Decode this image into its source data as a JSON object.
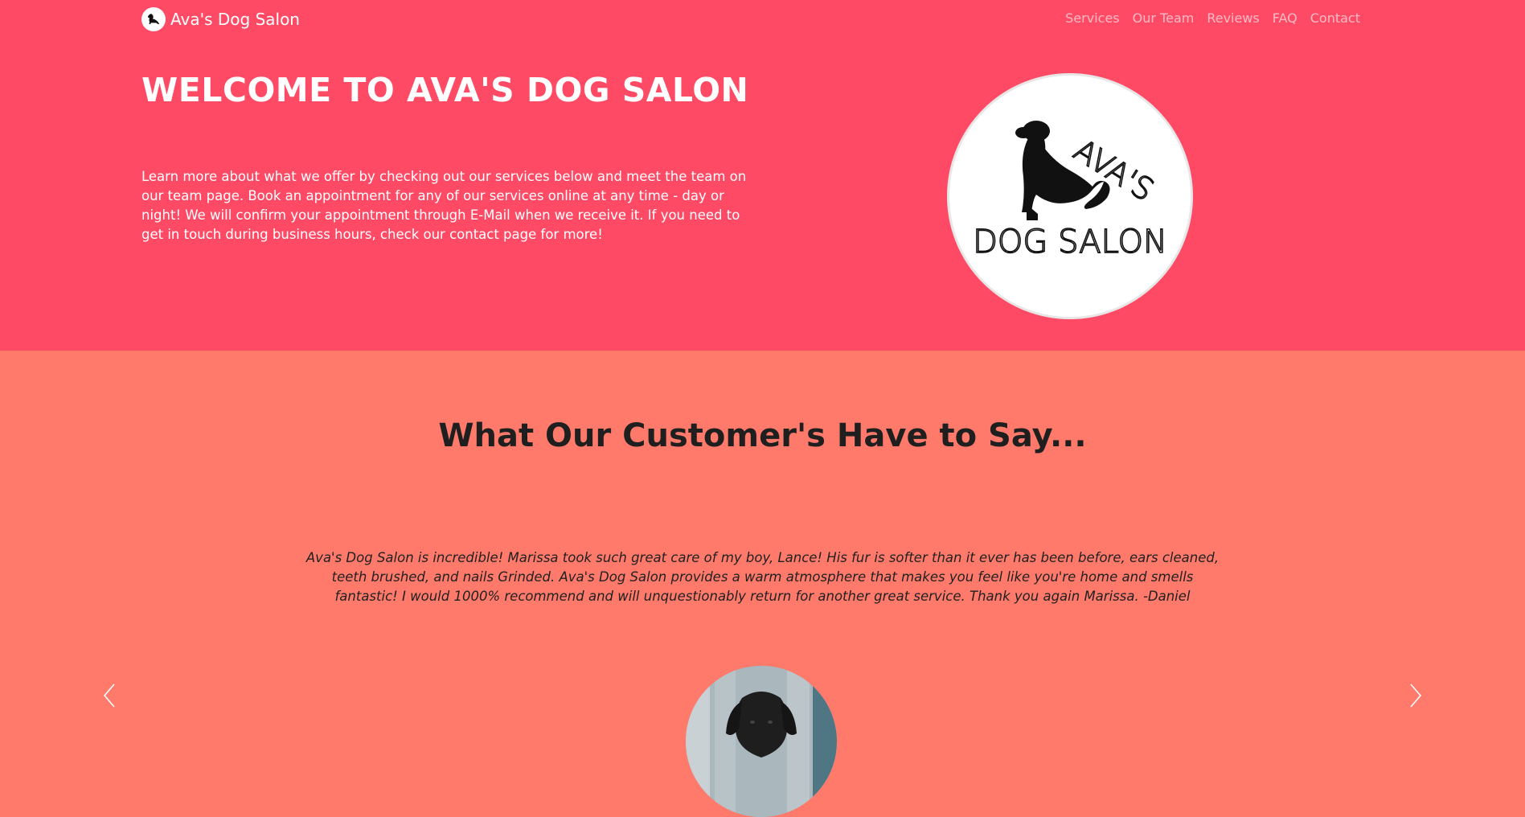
{
  "brand": {
    "name": "Ava's Dog Salon"
  },
  "nav": {
    "links": [
      "Services",
      "Our Team",
      "Reviews",
      "FAQ",
      "Contact"
    ]
  },
  "hero": {
    "title": "WELCOME TO AVA'S DOG SALON",
    "text": "Learn more about what we offer by checking out our services below and meet the team on our team page. Book an appointment for any of our services online at any time - day or night! We will confirm your appointment through E-Mail when we receive it. If you need to get in touch during business hours, check our contact page for more!",
    "logo_text": [
      "AVA'S",
      "DOG SALON"
    ]
  },
  "reviews": {
    "title": "What Our Customer's Have to Say...",
    "quote": "Ava's Dog Salon is incredible! Marissa took such great care of my boy, Lance! His fur is softer than it ever has been before, ears cleaned, teeth brushed, and nails Grinded. Ava's Dog Salon provides a warm atmosphere that makes you feel like you're home and smells fantastic! I would 1000% recommend and will unquestionably return for another great service. Thank you again Marissa. -Daniel"
  },
  "colors": {
    "hero_bg": "#ff4a66",
    "reviews_bg": "#ff7a6b",
    "text_dark": "#1f1f1f"
  },
  "icons": {
    "brand": "dog-silhouette-icon",
    "prev": "chevron-left-icon",
    "next": "chevron-right-icon"
  }
}
